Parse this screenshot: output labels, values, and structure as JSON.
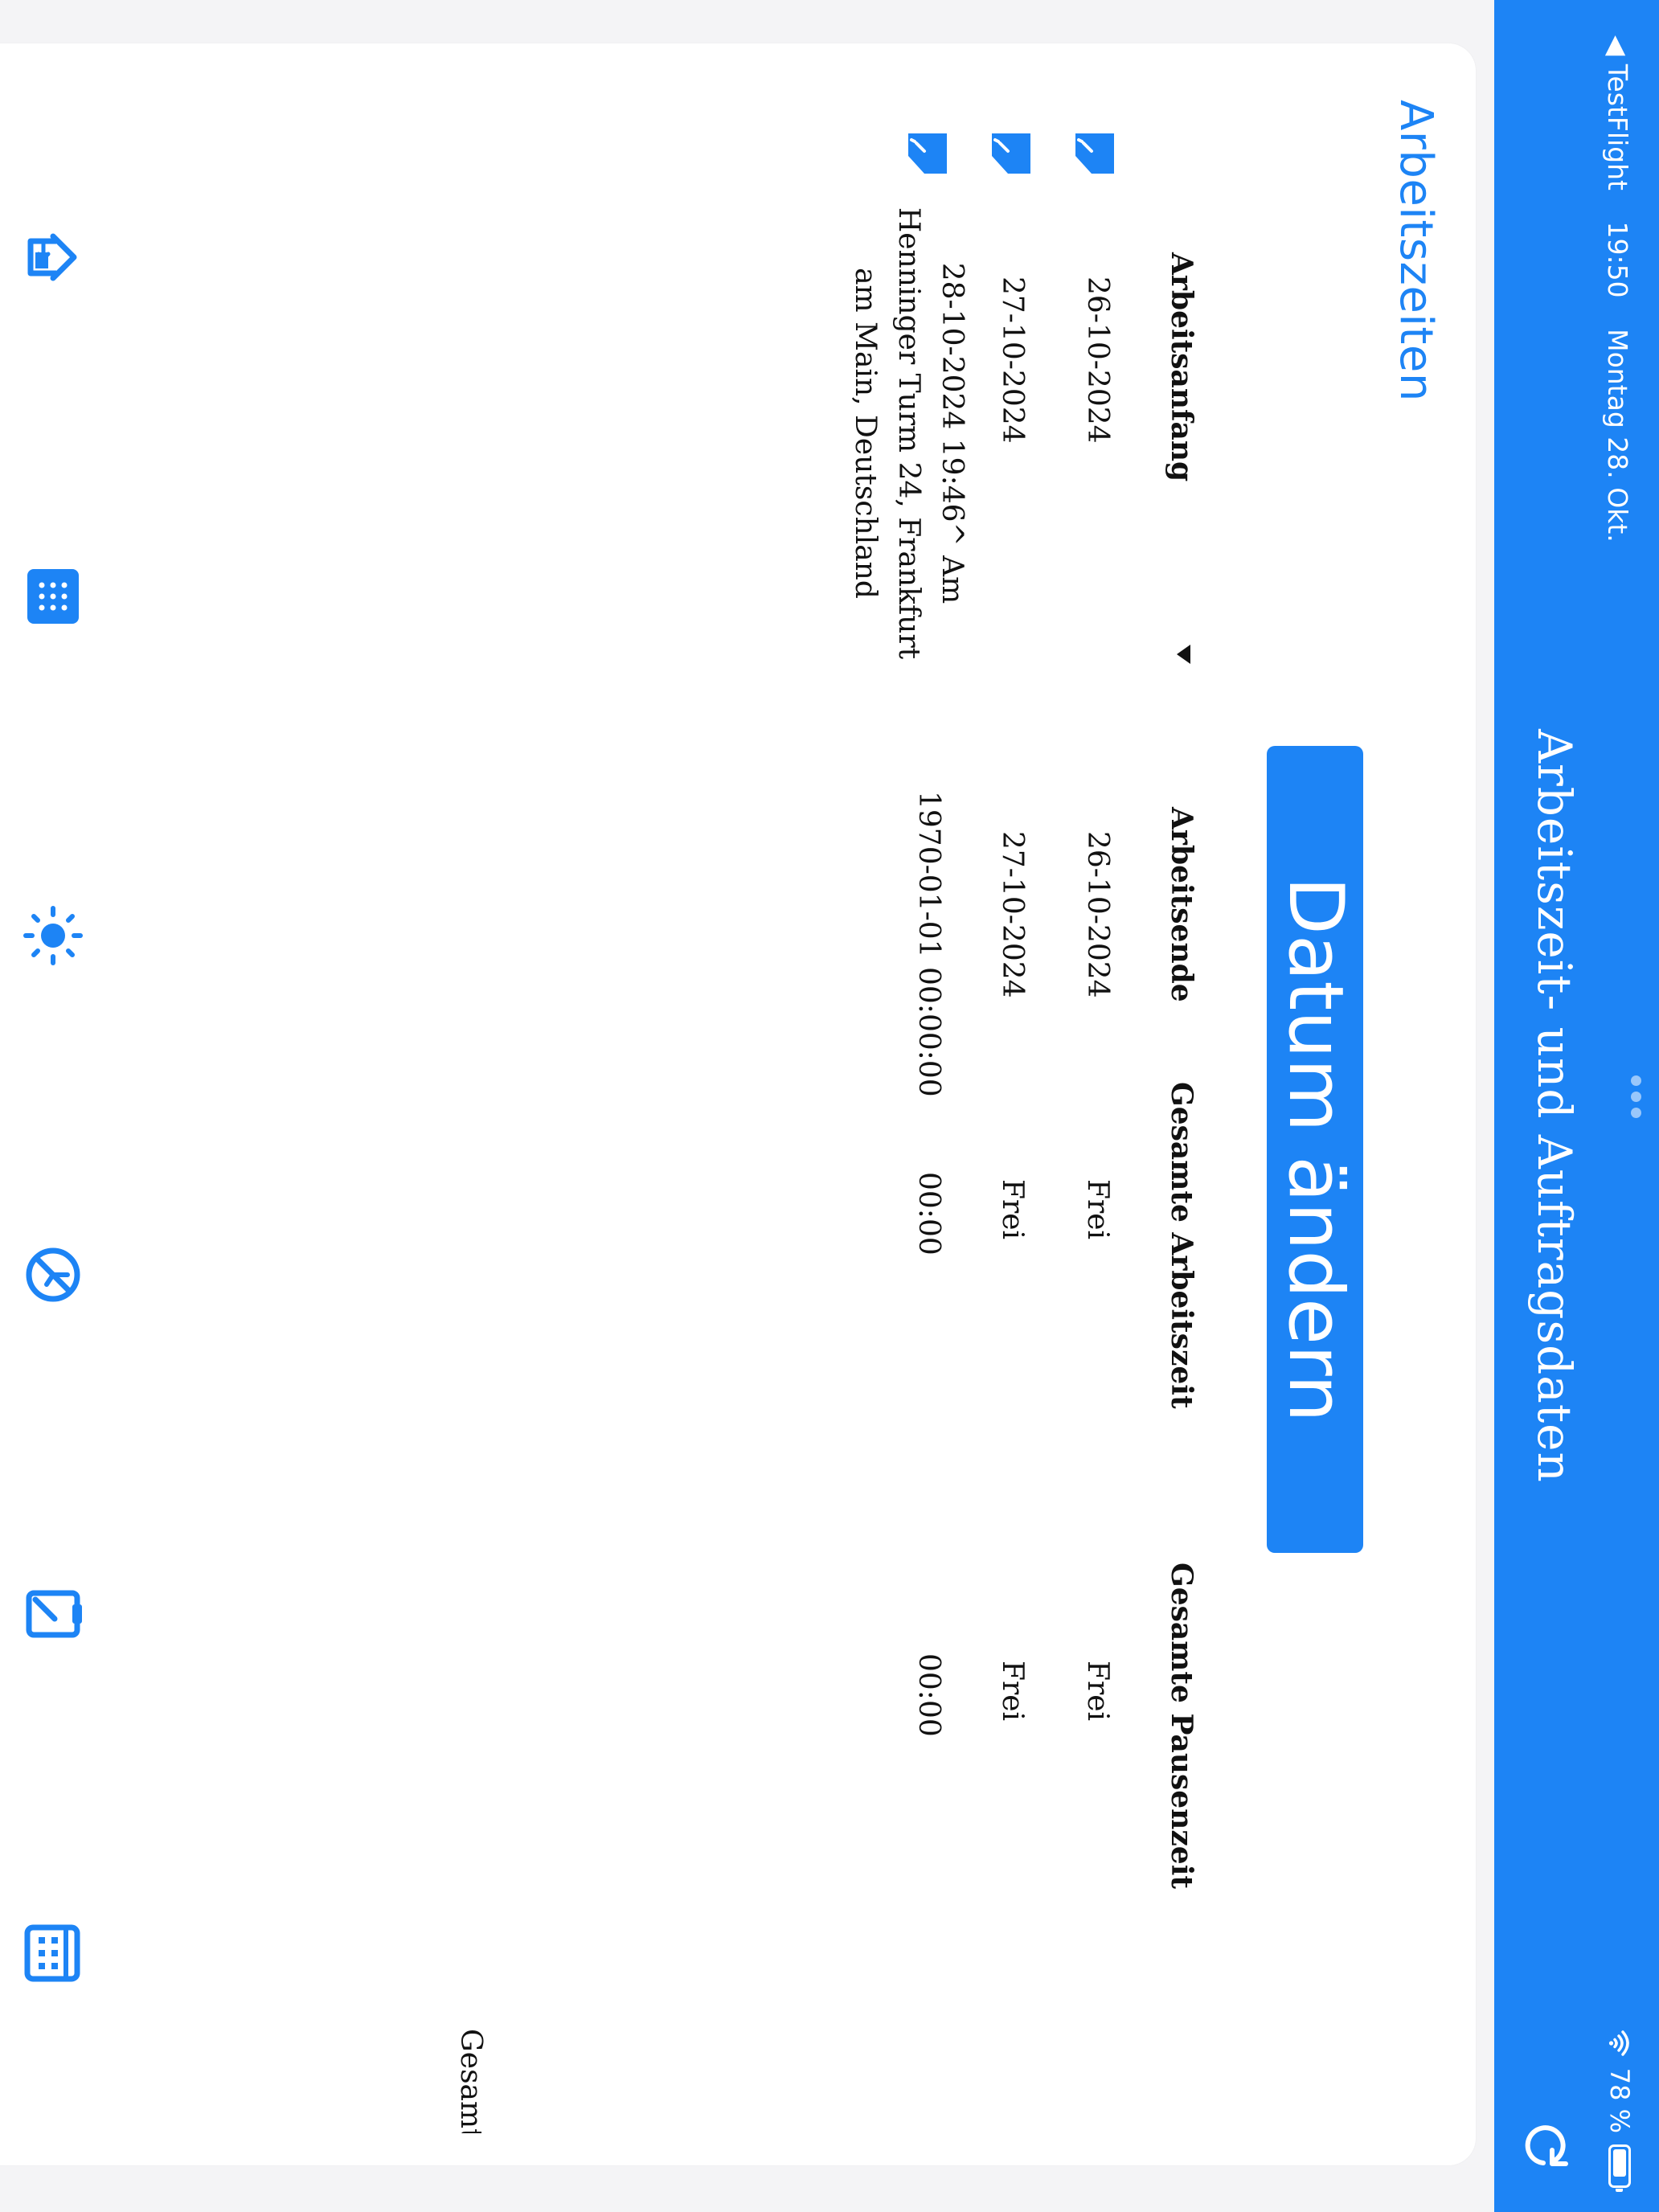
{
  "status_bar": {
    "back_app": "◀ TestFlight",
    "time": "19:50",
    "date": "Montag 28. Okt.",
    "battery": "78 %"
  },
  "header": {
    "title": "Arbeitszeit- und Auftragsdaten",
    "refresh_icon": "refresh-icon"
  },
  "section": {
    "title": "Arbeitszeiten"
  },
  "date_button": {
    "label": "Datum ändern"
  },
  "table": {
    "columns": [
      "Arbeitsanfang",
      "Arbeitsende",
      "Gesamte Arbeitszeit",
      "Gesamte Pausenzeit"
    ],
    "rows": [
      {
        "start": "26-10-2024",
        "end": "26-10-2024",
        "work": "Frei",
        "pause": "Frei"
      },
      {
        "start": "27-10-2024",
        "end": "27-10-2024",
        "work": "Frei",
        "pause": "Frei"
      },
      {
        "start": "28-10-2024 19:46^ Am Henninger Turm 24, Frankfurt am Main, Deutschland",
        "end": "1970-01-01 00:00:00",
        "work": "00:00",
        "pause": "00:00"
      }
    ]
  },
  "footer": {
    "partial": "Gesamt"
  },
  "toolbar": {
    "icons": [
      "home-login-icon",
      "calculator-icon",
      "sun-icon",
      "no-time-icon",
      "clipboard-edit-icon",
      "calendar-grid-icon"
    ]
  },
  "colors": {
    "accent": "#1d84f5",
    "background": "#f4f4f6",
    "card": "#ffffff"
  }
}
